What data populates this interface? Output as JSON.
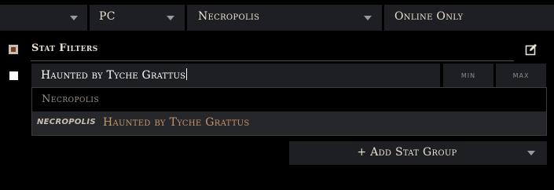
{
  "topbar": {
    "dropdowns": [
      {
        "label": ""
      },
      {
        "label": "PC"
      },
      {
        "label": "Necropolis"
      },
      {
        "label": "Online Only"
      }
    ]
  },
  "stat_filters": {
    "title": "Stat Filters",
    "search_value": "Haunted by Tyche Grattus",
    "min_label": "min",
    "max_label": "max",
    "suggestions": {
      "group_header": "Necropolis",
      "options": [
        {
          "tag": "NECROPOLIS",
          "name": "Haunted by Tyche Grattus"
        }
      ]
    },
    "add_group_label": "+ Add Stat Group"
  },
  "colors": {
    "background": "#000000",
    "field": "#1e1f22",
    "option_highlight": "#26272a",
    "accent_text": "#c7956a"
  },
  "icons": [
    "chevron-down-icon",
    "checkbox-icon",
    "edit-icon"
  ]
}
